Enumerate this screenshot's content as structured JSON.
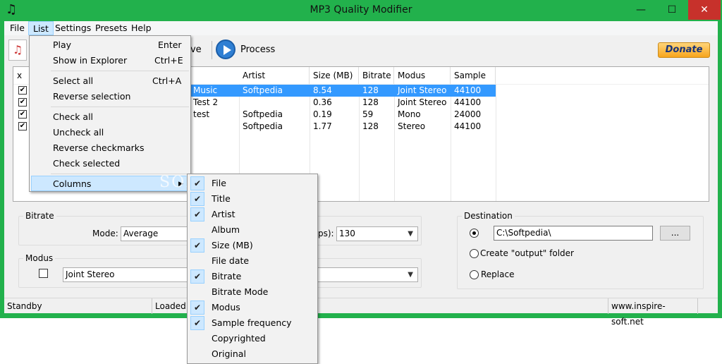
{
  "window": {
    "title": "MP3 Quality Modifier",
    "minimize": "—",
    "maximize": "☐",
    "close": "✕"
  },
  "menubar": [
    "File",
    "List",
    "Settings",
    "Presets",
    "Help"
  ],
  "toolbar": {
    "remove_partial": "ove",
    "process": "Process",
    "donate": "Donate"
  },
  "list": {
    "headers": [
      "x",
      "Artist",
      "Size  (MB)",
      "Bitrate",
      "Modus",
      "Sample fr..."
    ],
    "rows": [
      {
        "checked": true,
        "title": "Music",
        "artist": "Softpedia",
        "size": "8.54",
        "bitrate": "128",
        "modus": "Joint Stereo",
        "sample": "44100",
        "selected": true
      },
      {
        "checked": true,
        "title": "Test 2",
        "artist": "",
        "size": "0.36",
        "bitrate": "128",
        "modus": "Joint Stereo",
        "sample": "44100",
        "selected": false
      },
      {
        "checked": true,
        "title": "test",
        "artist": "Softpedia",
        "size": "0.19",
        "bitrate": "59",
        "modus": "Mono",
        "sample": "24000",
        "selected": false
      },
      {
        "checked": true,
        "title": "",
        "artist": "Softpedia",
        "size": "1.77",
        "bitrate": "128",
        "modus": "Stereo",
        "sample": "44100",
        "selected": false
      }
    ]
  },
  "bitrate": {
    "label": "Bitrate",
    "mode_label": "Mode:",
    "mode_value": "Average",
    "kbps_label": "ps):",
    "kbps_value": "130"
  },
  "modus": {
    "label": "Modus",
    "value": "Joint Stereo"
  },
  "destination": {
    "label": "Destination",
    "path": "C:\\Softpedia\\",
    "browse": "...",
    "create_output": "Create \"output\" folder",
    "replace": "Replace"
  },
  "status": {
    "left": "Standby",
    "middle": "Loaded",
    "right": "www.inspire-soft.net"
  },
  "list_menu": {
    "items": [
      {
        "label": "Play",
        "shortcut": "Enter"
      },
      {
        "label": "Show in Explorer",
        "shortcut": "Ctrl+E"
      },
      {
        "label": "Select all",
        "shortcut": "Ctrl+A"
      },
      {
        "label": "Reverse selection",
        "shortcut": ""
      },
      {
        "label": "Check all",
        "shortcut": ""
      },
      {
        "label": "Uncheck all",
        "shortcut": ""
      },
      {
        "label": "Reverse checkmarks",
        "shortcut": ""
      },
      {
        "label": "Check selected",
        "shortcut": ""
      },
      {
        "label": "Columns",
        "shortcut": ""
      }
    ]
  },
  "columns_menu": [
    {
      "label": "File",
      "checked": true
    },
    {
      "label": "Title",
      "checked": true
    },
    {
      "label": "Artist",
      "checked": true
    },
    {
      "label": "Album",
      "checked": false
    },
    {
      "label": "Size  (MB)",
      "checked": true
    },
    {
      "label": "File date",
      "checked": false
    },
    {
      "label": "Bitrate",
      "checked": true
    },
    {
      "label": "Bitrate Mode",
      "checked": false
    },
    {
      "label": "Modus",
      "checked": true
    },
    {
      "label": "Sample frequency",
      "checked": true
    },
    {
      "label": "Copyrighted",
      "checked": false
    },
    {
      "label": "Original",
      "checked": false
    }
  ],
  "watermark": "SOFTPEDIA",
  "colors": {
    "accent": "#22b14c",
    "selection": "#3399ff",
    "close": "#c7312b"
  },
  "icons": {
    "app": "music-note-icon",
    "file": "music-file-icon",
    "process": "play-circle-icon",
    "check": "checkmark-icon",
    "submenu": "submenu-arrow-icon"
  }
}
